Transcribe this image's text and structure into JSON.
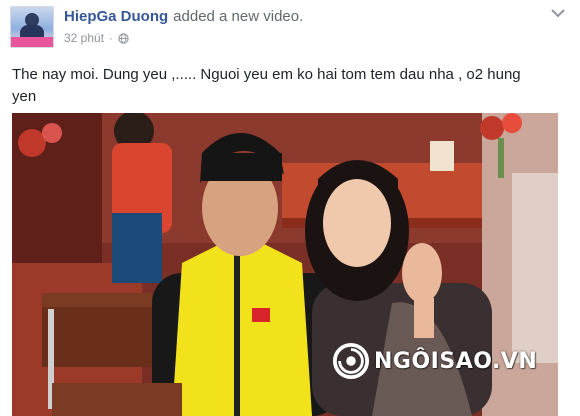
{
  "post": {
    "author": "HiepGa Duong",
    "action": "added a new video.",
    "time": "32 phút",
    "dot": "·",
    "privacy_icon": "globe-icon",
    "options_icon": "chevron-down-icon",
    "text": "The nay moi. Dung yeu ,..... Nguoi yeu em ko hai tom tem dau nha , o2 hung yen"
  },
  "video": {
    "watermark": "NGÔISAO.VN",
    "watermark_icon": "ngoisao-logo"
  },
  "colors": {
    "author": "#365899",
    "secondary_text": "#90949c",
    "body_text": "#1d2129"
  }
}
